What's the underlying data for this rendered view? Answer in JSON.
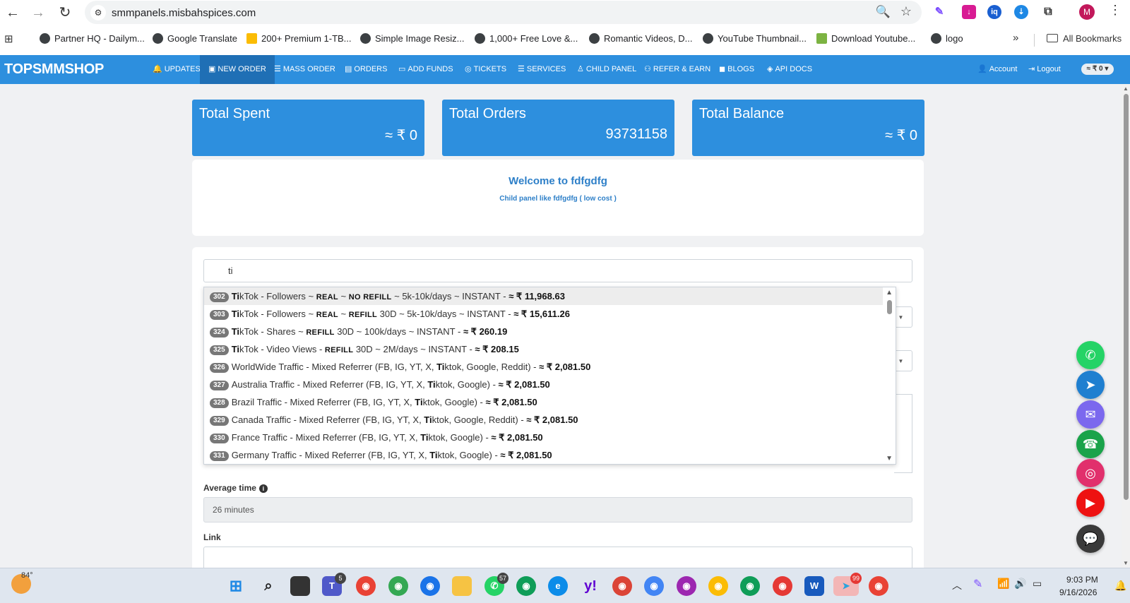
{
  "browser": {
    "url": "smmpanels.misbahspices.com",
    "bookmarks": [
      "Partner HQ - Dailym...",
      "Google Translate",
      "200+ Premium 1-TB...",
      "Simple Image Resiz...",
      "1,000+ Free Love &...",
      "Romantic Videos, D...",
      "YouTube Thumbnail...",
      "Download Youtube...",
      "logo"
    ],
    "all_bookmarks": "All Bookmarks",
    "avatar_letter": "M"
  },
  "nav": {
    "brand": "TOPSMMSHOP",
    "items": [
      "UPDATES",
      "NEW ORDER",
      "MASS ORDER",
      "ORDERS",
      "ADD FUNDS",
      "TICKETS",
      "SERVICES",
      "CHILD PANEL",
      "REFER & EARN",
      "BLOGS",
      "API DOCS"
    ],
    "active": "NEW ORDER",
    "account": "Account",
    "logout": "Logout",
    "balance_pill": "≈ ₹ 0"
  },
  "stats": [
    {
      "title": "Total Spent",
      "value": "≈ ₹ 0"
    },
    {
      "title": "Total Orders",
      "value": "93731158"
    },
    {
      "title": "Total Balance",
      "value": "≈ ₹ 0"
    }
  ],
  "welcome": {
    "title": "Welcome to fdfgdfg",
    "subtitle": "Child panel like fdfgdfg ( low cost )"
  },
  "search": {
    "value": "ti"
  },
  "dropdown": [
    {
      "id": "302",
      "pre": "",
      "hl": "Ti",
      "rest": "kTok - Followers ~ ",
      "b1": "REAL",
      "m1": " ~ ",
      "b2": "NO REFILL",
      "m2": " ~ 5k-10k/days ~ INSTANT - ",
      "price": "≈ ₹ 11,968.63"
    },
    {
      "id": "303",
      "pre": "",
      "hl": "Ti",
      "rest": "kTok - Followers ~ ",
      "b1": "REAL",
      "m1": " ~ ",
      "b2": "REFILL",
      "m2": " 30D ~ 5k-10k/days ~ INSTANT - ",
      "price": "≈ ₹ 15,611.26"
    },
    {
      "id": "324",
      "pre": "",
      "hl": "Ti",
      "rest": "kTok - Shares ~ ",
      "b1": "REFILL",
      "m1": " 30D ~ 100k/days ~ INSTANT - ",
      "b2": "",
      "m2": "",
      "price": "≈ ₹ 260.19"
    },
    {
      "id": "325",
      "pre": "",
      "hl": "Ti",
      "rest": "kTok - Video Views - ",
      "b1": "REFILL",
      "m1": " 30D ~ 2M/days ~ INSTANT - ",
      "b2": "",
      "m2": "",
      "price": "≈ ₹ 208.15"
    },
    {
      "id": "326",
      "pre": "WorldWide Traffic - Mixed Referrer (FB, IG, YT, X, ",
      "hl": "Ti",
      "rest": "ktok, Google, Reddit) - ",
      "b1": "",
      "m1": "",
      "b2": "",
      "m2": "",
      "price": "≈ ₹ 2,081.50"
    },
    {
      "id": "327",
      "pre": "Australia Traffic - Mixed Referrer (FB, IG, YT, X, ",
      "hl": "Ti",
      "rest": "ktok, Google) - ",
      "b1": "",
      "m1": "",
      "b2": "",
      "m2": "",
      "price": "≈ ₹ 2,081.50"
    },
    {
      "id": "328",
      "pre": "Brazil Traffic - Mixed Referrer (FB, IG, YT, X, ",
      "hl": "Ti",
      "rest": "ktok, Google) - ",
      "b1": "",
      "m1": "",
      "b2": "",
      "m2": "",
      "price": "≈ ₹ 2,081.50"
    },
    {
      "id": "329",
      "pre": "Canada Traffic - Mixed Referrer (FB, IG, YT, X, ",
      "hl": "Ti",
      "rest": "ktok, Google, Reddit) - ",
      "b1": "",
      "m1": "",
      "b2": "",
      "m2": "",
      "price": "≈ ₹ 2,081.50"
    },
    {
      "id": "330",
      "pre": "France Traffic - Mixed Referrer (FB, IG, YT, X, ",
      "hl": "Ti",
      "rest": "ktok, Google) - ",
      "b1": "",
      "m1": "",
      "b2": "",
      "m2": "",
      "price": "≈ ₹ 2,081.50"
    },
    {
      "id": "331",
      "pre": "Germany Traffic - Mixed Referrer (FB, IG, YT, X, ",
      "hl": "Ti",
      "rest": "ktok, Google) - ",
      "b1": "",
      "m1": "",
      "b2": "",
      "m2": "",
      "price": "≈ ₹ 2,081.50"
    }
  ],
  "form": {
    "avg_label": "Average time",
    "avg_value": "26 minutes",
    "link_label": "Link"
  },
  "float_buttons": [
    {
      "icon": "whatsapp-icon",
      "color": "#25d366"
    },
    {
      "icon": "telegram-icon",
      "color": "#1f7fd0"
    },
    {
      "icon": "email-icon",
      "color": "#7b68ee"
    },
    {
      "icon": "phone-icon",
      "color": "#1aa34a"
    },
    {
      "icon": "instagram-icon",
      "color": "#e1306c"
    },
    {
      "icon": "youtube-icon",
      "color": "#ee1111"
    },
    {
      "icon": "chat-icon",
      "color": "#3a3a3a"
    }
  ],
  "taskbar": {
    "temperature": "84°",
    "teams_badge": "5",
    "whatsapp_badge": "57",
    "telegram_badge": "99",
    "time": "9:03 PM",
    "date": "9/16/2026"
  },
  "colors": {
    "brand": "#2d8fde",
    "nav_active": "#1f6fb5",
    "welcome_text": "#2d7fc8"
  }
}
